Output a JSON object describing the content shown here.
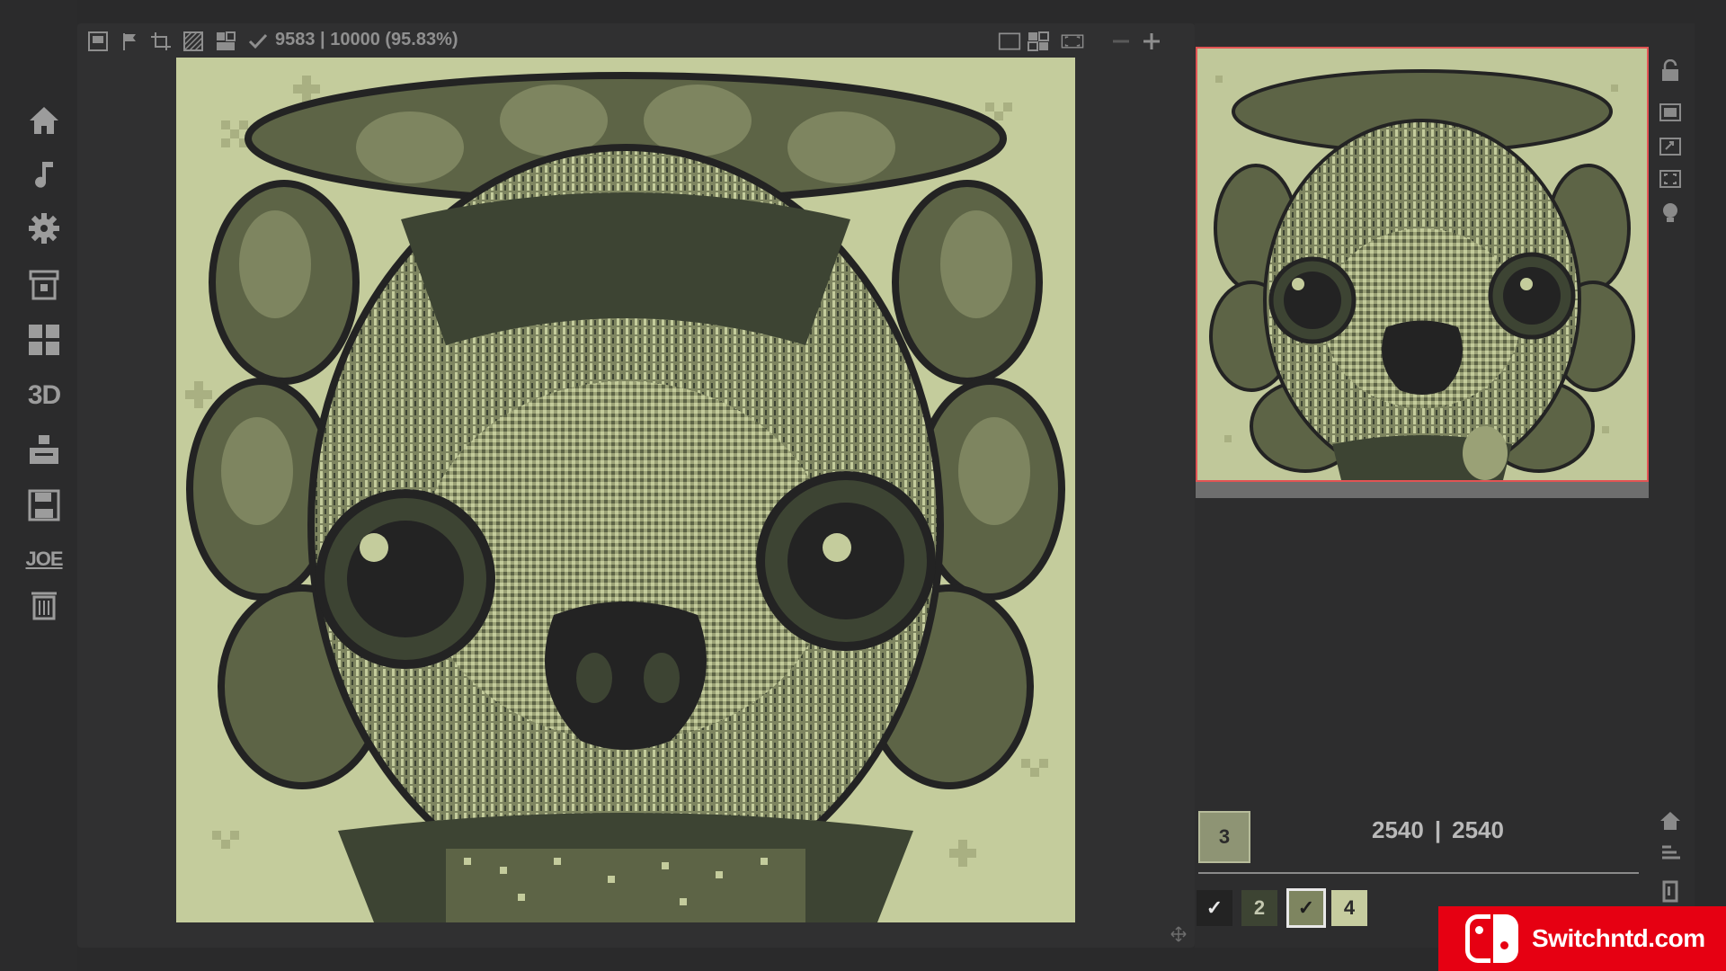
{
  "topbar": {
    "progress": "9583 | 10000 (95.83%)",
    "done": 9583,
    "total": 10000
  },
  "sidebar": {
    "items": [
      {
        "name": "home",
        "icon": "home-icon"
      },
      {
        "name": "music",
        "icon": "music-note-icon"
      },
      {
        "name": "settings",
        "icon": "gear-icon"
      },
      {
        "name": "shop",
        "icon": "shop-icon"
      },
      {
        "name": "gallery",
        "icon": "grid-icon"
      },
      {
        "name": "3d",
        "label": "3D"
      },
      {
        "name": "import",
        "icon": "import-icon"
      },
      {
        "name": "save",
        "icon": "floppy-icon"
      },
      {
        "name": "joe",
        "label": "JOE"
      },
      {
        "name": "delete",
        "icon": "trash-icon"
      }
    ]
  },
  "layer": {
    "current": "3"
  },
  "dims": {
    "width": "2540",
    "sep": "|",
    "height": "2540"
  },
  "palette": [
    {
      "label": "✓",
      "color": "#232323"
    },
    {
      "label": "2",
      "color": "#3d4433"
    },
    {
      "label": "✓",
      "color": "#7e8560"
    },
    {
      "label": "4",
      "color": "#c6cc9f"
    }
  ],
  "brand": {
    "text": "Switchntd.com"
  },
  "colors": {
    "accent_red": "#e25454",
    "lightest": "#c4cc9c",
    "dark": "#232323"
  }
}
